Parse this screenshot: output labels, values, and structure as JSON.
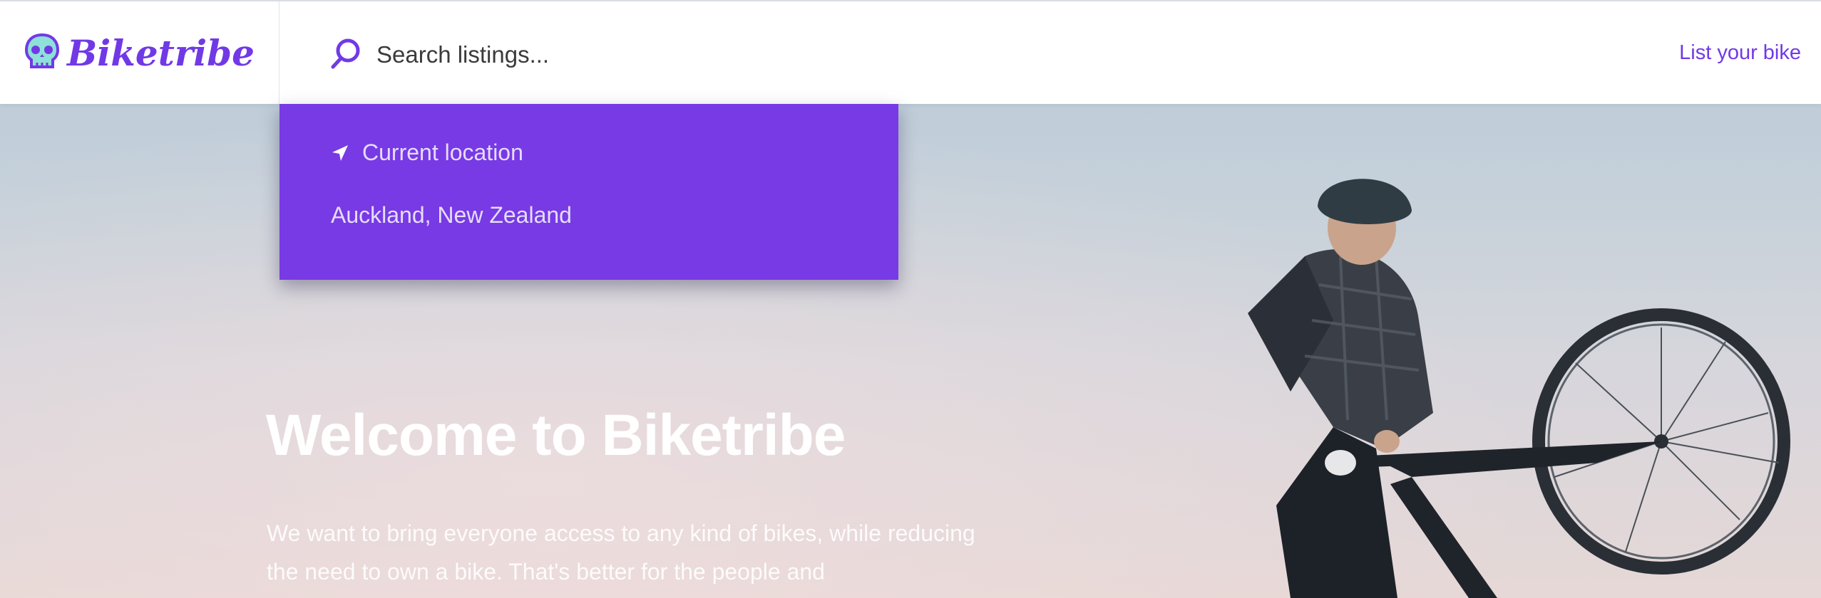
{
  "header": {
    "brand": "Biketribe",
    "search_placeholder": "Search listings...",
    "list_bike_label": "List your bike"
  },
  "dropdown": {
    "current_location_label": "Current location",
    "suggestions": [
      "Auckland, New Zealand"
    ]
  },
  "hero": {
    "title": "Welcome to Biketribe",
    "description": "We want to bring everyone access to any kind of bikes, while reducing the need to own a bike. That's better for the people and"
  },
  "colors": {
    "accent": "#7139e6",
    "dropdown_bg": "#773ae5"
  },
  "icons": {
    "logo": "skull-icon",
    "search": "search-icon",
    "location": "location-arrow-icon"
  }
}
